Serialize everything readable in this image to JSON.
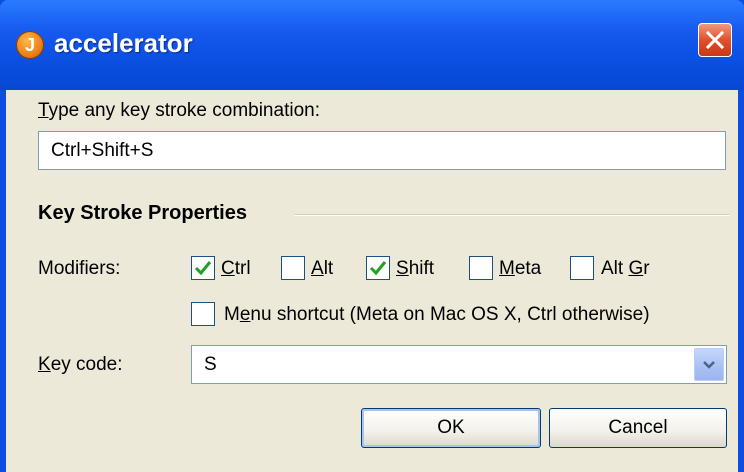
{
  "window": {
    "title": "accelerator",
    "app_icon_glyph": "J",
    "icon": "java-app-icon",
    "close_icon": "close-icon",
    "title_bar_color": "#0a4fe0",
    "close_button_color": "#e0502a"
  },
  "prompt": {
    "label_u": "T",
    "label_rest": "ype any key stroke combination:",
    "value": "Ctrl+Shift+S"
  },
  "properties": {
    "section_title": "Key Stroke Properties",
    "modifiers_label": "Modifiers:",
    "modifiers": [
      {
        "u": "C",
        "rest": "trl",
        "checked": true
      },
      {
        "u": "A",
        "rest": "lt",
        "checked": false
      },
      {
        "u": "S",
        "rest": "hift",
        "checked": true
      },
      {
        "u": "M",
        "rest": "eta",
        "checked": false
      },
      {
        "pre": "Alt ",
        "u": "G",
        "rest": "r",
        "checked": false
      }
    ],
    "menu_shortcut": {
      "pre": "M",
      "u": "e",
      "rest": "nu shortcut (Meta on Mac OS X, Ctrl otherwise)",
      "checked": false
    },
    "key_code_label_u": "K",
    "key_code_label_rest": "ey code:",
    "key_code_value": "S"
  },
  "buttons": {
    "ok": "OK",
    "cancel": "Cancel"
  },
  "check_color": "#21a121"
}
